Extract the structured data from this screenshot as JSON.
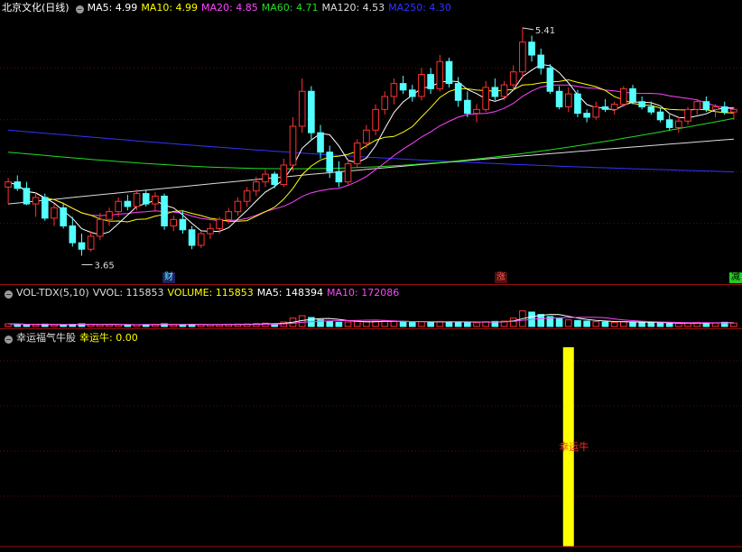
{
  "header": {
    "title": "北京文化(日线)",
    "ma_labels": [
      {
        "text": "MA5: 4.99",
        "color": "#ffffff"
      },
      {
        "text": "MA10: 4.99",
        "color": "#ffff00"
      },
      {
        "text": "MA20: 4.85",
        "color": "#ff44ff"
      },
      {
        "text": "MA60: 4.71",
        "color": "#22dd22"
      },
      {
        "text": "MA120: 4.53",
        "color": "#dddddd"
      },
      {
        "text": "MA250: 4.30",
        "color": "#3333ff"
      }
    ]
  },
  "vol_header": {
    "name": "VOL-TDX(5,10)",
    "vvol": "VVOL: 115853",
    "volume": "VOLUME: 115853",
    "ma5": "MA5: 148394",
    "ma10": "MA10: 172086"
  },
  "ind_header": {
    "name": "幸运福气牛股",
    "value": "幸运牛: 0.00",
    "bar_label": "幸运牛"
  },
  "markers": {
    "high": "5.41",
    "low": "3.65",
    "tag_cai": "财",
    "tag_zhang": "涨",
    "tag_jian": "减"
  },
  "colors": {
    "up": "#ff3232",
    "down": "#54ffff",
    "ma5": "#ffffff",
    "ma10": "#ffff00",
    "ma20": "#ff44ff",
    "ma60": "#22dd22",
    "ma120": "#dddddd",
    "ma250": "#3333ff",
    "signal": "#ffff00"
  },
  "chart_data": {
    "type": "candlestick",
    "price_range": [
      3.5,
      5.5
    ],
    "candles": [
      [
        4.18,
        4.25,
        4.05,
        4.22
      ],
      [
        4.22,
        4.27,
        4.15,
        4.17
      ],
      [
        4.17,
        4.22,
        4.04,
        4.05
      ],
      [
        4.05,
        4.14,
        3.95,
        4.1
      ],
      [
        4.1,
        4.13,
        3.92,
        3.94
      ],
      [
        3.94,
        4.05,
        3.88,
        4.02
      ],
      [
        4.02,
        4.06,
        3.86,
        3.88
      ],
      [
        3.88,
        3.95,
        3.72,
        3.75
      ],
      [
        3.75,
        3.82,
        3.65,
        3.7
      ],
      [
        3.7,
        3.84,
        3.68,
        3.8
      ],
      [
        3.8,
        3.98,
        3.77,
        3.93
      ],
      [
        3.93,
        4.02,
        3.88,
        3.99
      ],
      [
        3.99,
        4.1,
        3.95,
        4.07
      ],
      [
        4.07,
        4.12,
        4.0,
        4.03
      ],
      [
        4.03,
        4.16,
        4.0,
        4.13
      ],
      [
        4.13,
        4.16,
        4.03,
        4.05
      ],
      [
        4.05,
        4.14,
        3.99,
        4.11
      ],
      [
        4.11,
        4.13,
        3.85,
        3.88
      ],
      [
        3.88,
        3.96,
        3.84,
        3.93
      ],
      [
        3.93,
        4.0,
        3.82,
        3.85
      ],
      [
        3.85,
        3.88,
        3.7,
        3.73
      ],
      [
        3.73,
        3.84,
        3.71,
        3.82
      ],
      [
        3.82,
        3.9,
        3.78,
        3.86
      ],
      [
        3.86,
        3.95,
        3.82,
        3.93
      ],
      [
        3.93,
        4.02,
        3.9,
        3.99
      ],
      [
        3.99,
        4.1,
        3.96,
        4.07
      ],
      [
        4.07,
        4.18,
        4.03,
        4.15
      ],
      [
        4.15,
        4.26,
        4.11,
        4.22
      ],
      [
        4.22,
        4.32,
        4.18,
        4.28
      ],
      [
        4.28,
        4.3,
        4.17,
        4.2
      ],
      [
        4.2,
        4.4,
        4.18,
        4.35
      ],
      [
        4.35,
        4.72,
        4.3,
        4.65
      ],
      [
        4.65,
        5.02,
        4.6,
        4.92
      ],
      [
        4.92,
        4.96,
        4.55,
        4.6
      ],
      [
        4.6,
        4.66,
        4.4,
        4.45
      ],
      [
        4.45,
        4.5,
        4.25,
        4.3
      ],
      [
        4.3,
        4.38,
        4.18,
        4.22
      ],
      [
        4.22,
        4.4,
        4.2,
        4.36
      ],
      [
        4.36,
        4.55,
        4.33,
        4.52
      ],
      [
        4.52,
        4.66,
        4.48,
        4.62
      ],
      [
        4.62,
        4.82,
        4.58,
        4.78
      ],
      [
        4.78,
        4.92,
        4.74,
        4.88
      ],
      [
        4.88,
        5.02,
        4.82,
        4.98
      ],
      [
        4.98,
        5.04,
        4.9,
        4.93
      ],
      [
        4.93,
        4.97,
        4.84,
        4.88
      ],
      [
        4.88,
        5.1,
        4.85,
        5.05
      ],
      [
        5.05,
        5.1,
        4.9,
        4.94
      ],
      [
        4.94,
        5.2,
        4.92,
        5.15
      ],
      [
        5.15,
        5.18,
        4.95,
        4.98
      ],
      [
        4.98,
        5.03,
        4.8,
        4.85
      ],
      [
        4.85,
        4.92,
        4.72,
        4.75
      ],
      [
        4.75,
        4.82,
        4.68,
        4.78
      ],
      [
        4.78,
        5.0,
        4.76,
        4.95
      ],
      [
        4.95,
        5.02,
        4.85,
        4.88
      ],
      [
        4.88,
        5.0,
        4.85,
        4.97
      ],
      [
        4.97,
        5.12,
        4.93,
        5.07
      ],
      [
        5.07,
        5.41,
        5.02,
        5.3
      ],
      [
        5.3,
        5.35,
        5.15,
        5.2
      ],
      [
        5.2,
        5.25,
        5.05,
        5.1
      ],
      [
        5.1,
        5.13,
        4.9,
        4.92
      ],
      [
        4.92,
        4.96,
        4.78,
        4.8
      ],
      [
        4.8,
        4.95,
        4.76,
        4.9
      ],
      [
        4.9,
        4.93,
        4.72,
        4.75
      ],
      [
        4.75,
        4.78,
        4.68,
        4.72
      ],
      [
        4.72,
        4.84,
        4.7,
        4.8
      ],
      [
        4.8,
        4.86,
        4.76,
        4.78
      ],
      [
        4.78,
        4.84,
        4.74,
        4.82
      ],
      [
        4.82,
        4.96,
        4.8,
        4.94
      ],
      [
        4.94,
        4.97,
        4.82,
        4.84
      ],
      [
        4.84,
        4.88,
        4.78,
        4.8
      ],
      [
        4.8,
        4.84,
        4.74,
        4.76
      ],
      [
        4.76,
        4.79,
        4.68,
        4.7
      ],
      [
        4.7,
        4.74,
        4.62,
        4.64
      ],
      [
        4.64,
        4.72,
        4.6,
        4.69
      ],
      [
        4.69,
        4.8,
        4.66,
        4.78
      ],
      [
        4.78,
        4.86,
        4.74,
        4.84
      ],
      [
        4.84,
        4.88,
        4.76,
        4.78
      ],
      [
        4.78,
        4.82,
        4.72,
        4.8
      ],
      [
        4.8,
        4.84,
        4.74,
        4.76
      ],
      [
        4.76,
        4.8,
        4.7,
        4.78
      ]
    ],
    "volume_range": [
      0,
      900000
    ],
    "volumes": [
      90000,
      70000,
      65000,
      60000,
      80000,
      60000,
      55000,
      70000,
      90000,
      75000,
      60000,
      58000,
      62000,
      55000,
      60000,
      65000,
      70000,
      90000,
      60000,
      55000,
      70000,
      65000,
      60000,
      62000,
      70000,
      80000,
      85000,
      95000,
      110000,
      90000,
      150000,
      280000,
      360000,
      300000,
      220000,
      170000,
      140000,
      150000,
      180000,
      160000,
      170000,
      190000,
      180000,
      150000,
      140000,
      160000,
      150000,
      170000,
      160000,
      150000,
      140000,
      130000,
      160000,
      170000,
      180000,
      280000,
      520000,
      480000,
      400000,
      330000,
      260000,
      220000,
      200000,
      180000,
      160000,
      150000,
      140000,
      160000,
      150000,
      140000,
      120000,
      110000,
      100000,
      110000,
      120000,
      130000,
      120000,
      115853,
      140000,
      115853
    ],
    "signal_index": 61,
    "signal_value": 1
  }
}
